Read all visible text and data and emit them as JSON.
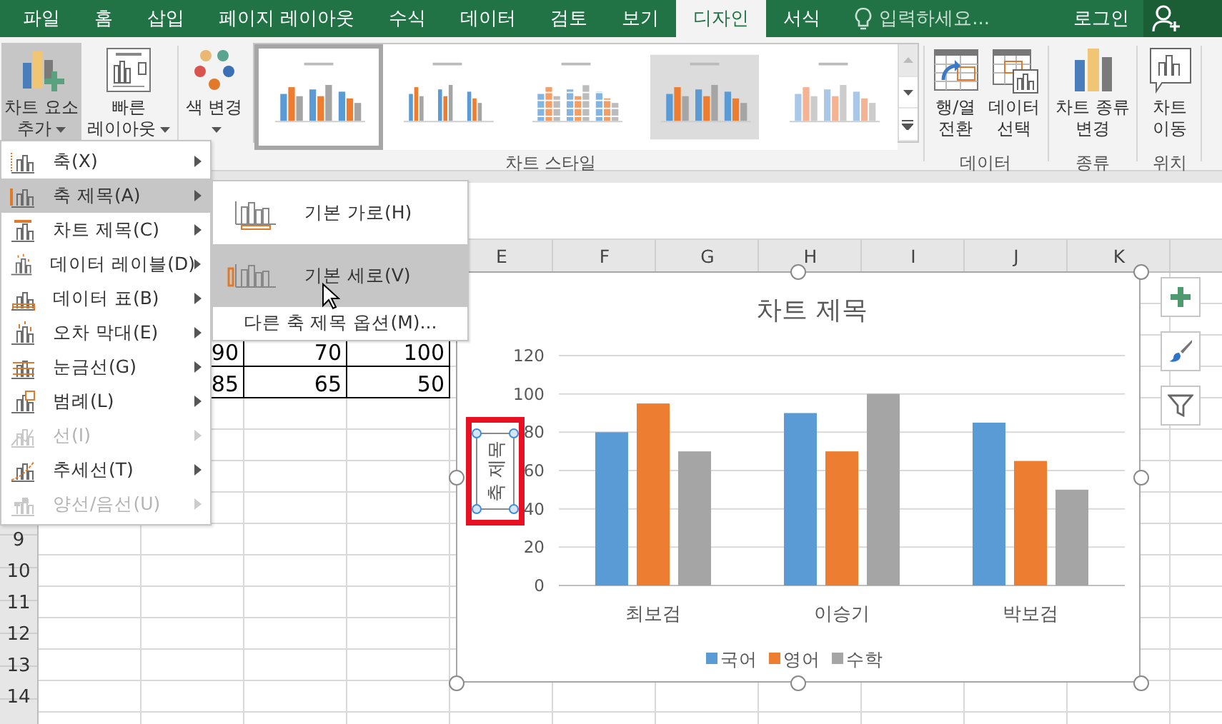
{
  "tabs": [
    {
      "label": "파일",
      "selected": false
    },
    {
      "label": "홈",
      "selected": false
    },
    {
      "label": "삽입",
      "selected": false
    },
    {
      "label": "페이지 레이아웃",
      "selected": false
    },
    {
      "label": "수식",
      "selected": false
    },
    {
      "label": "데이터",
      "selected": false
    },
    {
      "label": "검토",
      "selected": false
    },
    {
      "label": "보기",
      "selected": false
    },
    {
      "label": "디자인",
      "selected": true
    },
    {
      "label": "서식",
      "selected": false
    }
  ],
  "tell_me": {
    "placeholder": "입력하세요..."
  },
  "sign_in": "로그인",
  "ribbon": {
    "groups": [
      {
        "buttons": [
          {
            "kind": "add-element",
            "lines": [
              "차트 요소",
              "추가"
            ],
            "pressed": true,
            "dropdown": true
          },
          {
            "kind": "quick-layout",
            "lines": [
              "빠른",
              "레이아웃"
            ],
            "pressed": false,
            "dropdown": true
          }
        ]
      },
      {
        "label": "차트 스타일",
        "buttons": [
          {
            "kind": "colors",
            "lines": [
              "색 변경"
            ],
            "pressed": false,
            "dropdown": true
          }
        ],
        "gallery": [
          {
            "kind": "plain",
            "selected": true
          },
          {
            "kind": "labeled",
            "selected": false
          },
          {
            "kind": "striped",
            "selected": false
          },
          {
            "kind": "shaded",
            "selected": false
          },
          {
            "kind": "pale",
            "selected": false
          }
        ]
      },
      {
        "label": "데이터",
        "buttons": [
          {
            "kind": "switch",
            "lines": [
              "행/열",
              "전환"
            ],
            "pressed": false
          },
          {
            "kind": "select-data",
            "lines": [
              "데이터",
              "선택"
            ],
            "pressed": false
          }
        ]
      },
      {
        "label": "종류",
        "buttons": [
          {
            "kind": "change-type",
            "lines": [
              "차트 종류",
              "변경"
            ],
            "pressed": false
          }
        ]
      },
      {
        "label": "위치",
        "buttons": [
          {
            "kind": "move",
            "lines": [
              "차트",
              "이동"
            ],
            "pressed": false
          }
        ]
      }
    ]
  },
  "chart_menu": {
    "items": [
      {
        "kind": "axis",
        "label": "축(X)",
        "selected": false,
        "disabled": false
      },
      {
        "kind": "axis-title",
        "label": "축 제목(A)",
        "selected": true,
        "disabled": false
      },
      {
        "kind": "chart-title",
        "label": "차트 제목(C)",
        "selected": false,
        "disabled": false
      },
      {
        "kind": "data-labels",
        "label": "데이터 레이블(D)",
        "selected": false,
        "disabled": false
      },
      {
        "kind": "data-table",
        "label": "데이터 표(B)",
        "selected": false,
        "disabled": false
      },
      {
        "kind": "error-bars",
        "label": "오차 막대(E)",
        "selected": false,
        "disabled": false
      },
      {
        "kind": "gridlines",
        "label": "눈금선(G)",
        "selected": false,
        "disabled": false
      },
      {
        "kind": "legend",
        "label": "범례(L)",
        "selected": false,
        "disabled": false
      },
      {
        "kind": "lines",
        "label": "선(I)",
        "selected": false,
        "disabled": true
      },
      {
        "kind": "trendline",
        "label": "추세선(T)",
        "selected": false,
        "disabled": false
      },
      {
        "kind": "up-down-bars",
        "label": "양선/음선(U)",
        "selected": false,
        "disabled": true
      }
    ]
  },
  "submenu": {
    "items": [
      {
        "kind": "horizontal",
        "label": "기본 가로(H)",
        "selected": false
      },
      {
        "kind": "vertical",
        "label": "기본 세로(V)",
        "selected": true
      },
      {
        "kind": "more",
        "label": "다른 축 제목 옵션(M)...",
        "selected": false
      }
    ]
  },
  "sheet": {
    "columns": [
      "E",
      "F",
      "G",
      "H",
      "I",
      "J",
      "K"
    ],
    "row_numbers": [
      "9",
      "10",
      "11",
      "12",
      "13",
      "14"
    ],
    "table_rows": [
      [
        "90",
        "70",
        "100"
      ],
      [
        "85",
        "65",
        "50"
      ]
    ]
  },
  "chart": {
    "axis_title_selected": true,
    "chart_data": {
      "type": "bar",
      "title": "차트 제목",
      "ylabel": "축 제목",
      "categories": [
        "최보검",
        "이승기",
        "박보검"
      ],
      "series": [
        {
          "name": "국어",
          "color": "#5b9bd5",
          "values": [
            80,
            90,
            85
          ]
        },
        {
          "name": "영어",
          "color": "#ed7d31",
          "values": [
            95,
            70,
            65
          ]
        },
        {
          "name": "수학",
          "color": "#a5a5a5",
          "values": [
            70,
            100,
            50
          ]
        }
      ],
      "ylim": [
        0,
        120
      ],
      "yticks": [
        0,
        20,
        40,
        60,
        80,
        100,
        120
      ],
      "grid": true,
      "legend": true
    }
  }
}
